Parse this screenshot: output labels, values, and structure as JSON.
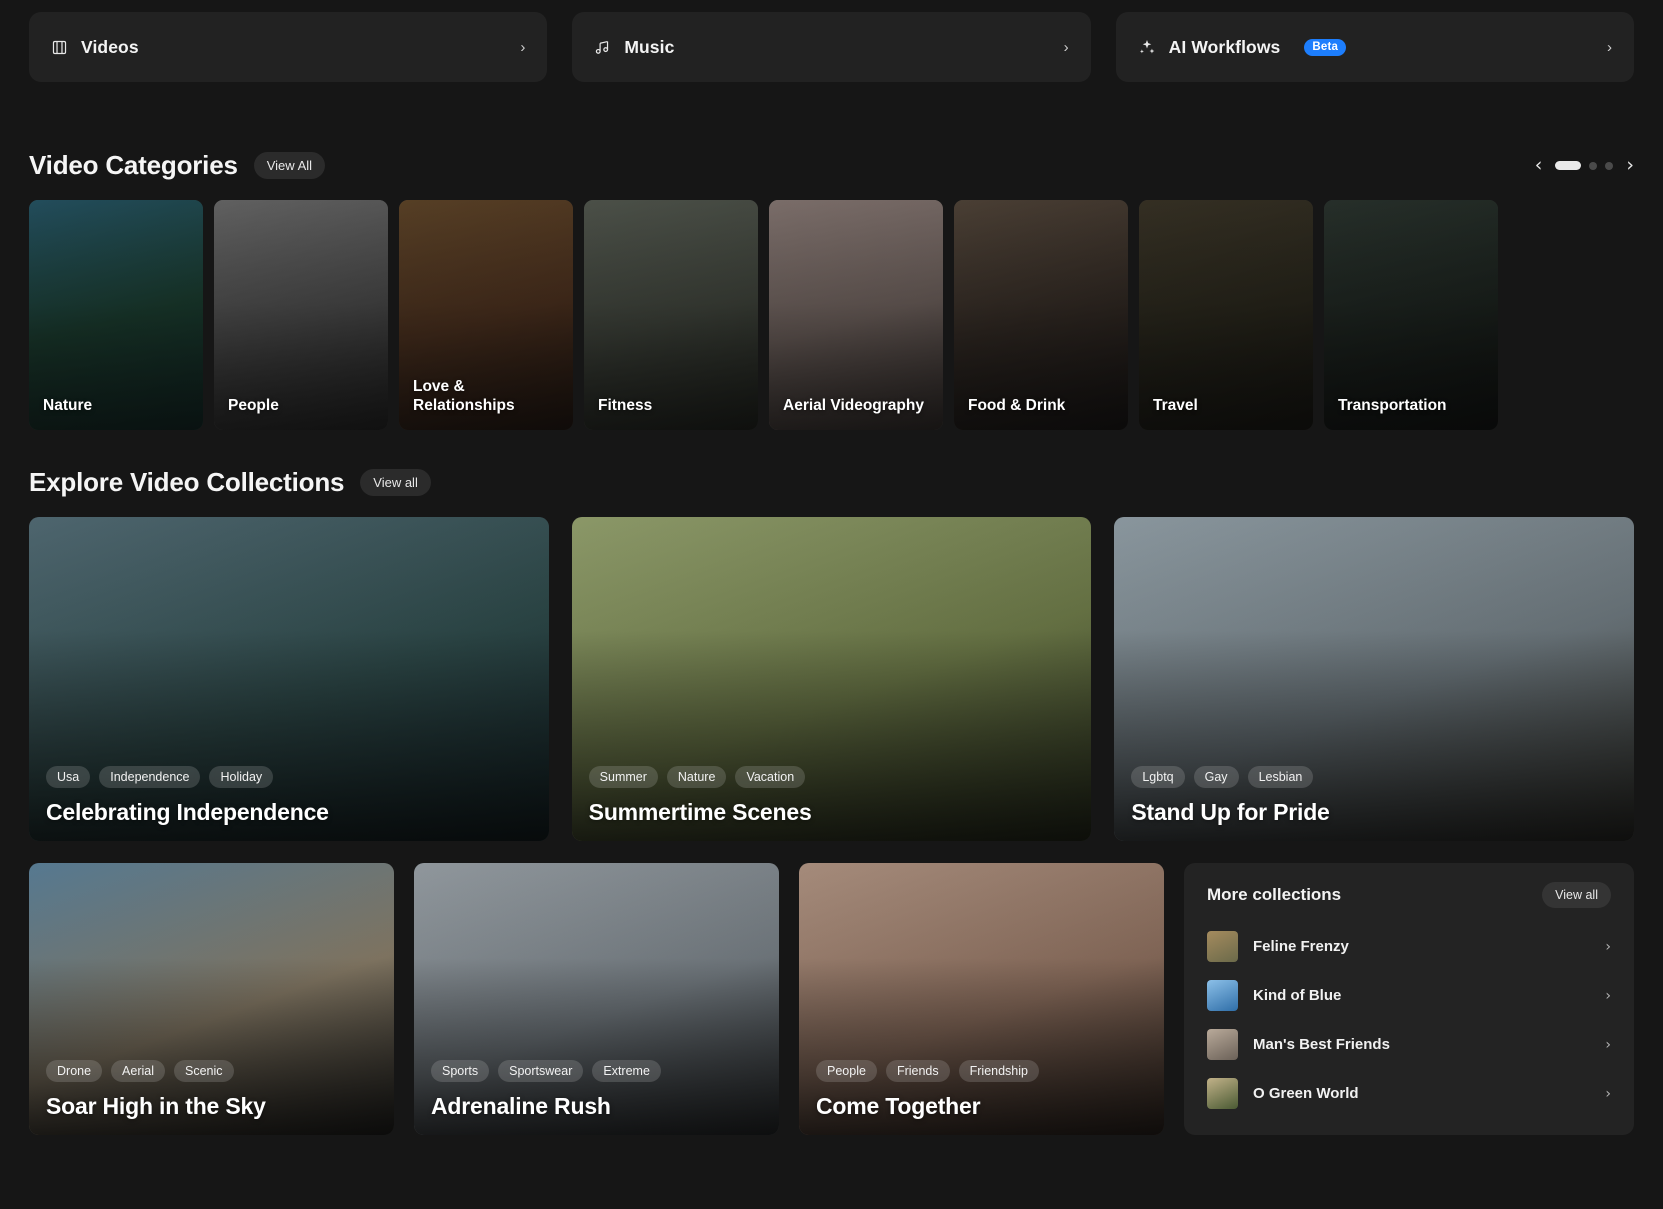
{
  "nav_tiles": [
    {
      "label": "Videos",
      "icon": "film-icon",
      "chevron": "›"
    },
    {
      "label": "Music",
      "icon": "music-note-icon",
      "chevron": "›"
    },
    {
      "label": "AI Workflows",
      "icon": "sparkles-icon",
      "badge": "Beta",
      "chevron": "›"
    }
  ],
  "video_categories": {
    "title": "Video Categories",
    "view_all_label": "View All",
    "prev_arrow": "‹",
    "next_arrow": "›",
    "pages": 3,
    "active_page": 1,
    "items": [
      {
        "label": "Nature",
        "c1": "#2f6f86",
        "c2": "#1d4a38",
        "c3": "#0d2c28"
      },
      {
        "label": "People",
        "c1": "#8d8d8d",
        "c2": "#5c5c5c",
        "c3": "#262626"
      },
      {
        "label": "Love & Relationships",
        "c1": "#7d5a33",
        "c2": "#5e3a22",
        "c3": "#24140c"
      },
      {
        "label": "Fitness",
        "c1": "#6d7468",
        "c2": "#4d5348",
        "c3": "#20241d"
      },
      {
        "label": "Aerial Videography",
        "c1": "#b4a09a",
        "c2": "#8b7a74",
        "c3": "#3b3330"
      },
      {
        "label": "Food & Drink",
        "c1": "#6b5a4a",
        "c2": "#3c3129",
        "c3": "#151110"
      },
      {
        "label": "Travel",
        "c1": "#4a4230",
        "c2": "#2f2c1e",
        "c3": "#14130d"
      },
      {
        "label": "Transportation",
        "c1": "#35423a",
        "c2": "#1f2822",
        "c3": "#0b0e0c"
      }
    ]
  },
  "explore_collections": {
    "title": "Explore Video Collections",
    "view_all_label": "View all",
    "featured": [
      {
        "title": "Celebrating Independence",
        "tags": [
          "Usa",
          "Independence",
          "Holiday"
        ],
        "c1": "#56707a",
        "c2": "#2e4a4a",
        "c3": "#14262a"
      },
      {
        "title": "Summertime Scenes",
        "tags": [
          "Summer",
          "Nature",
          "Vacation"
        ],
        "c1": "#9aa873",
        "c2": "#6e7b49",
        "c3": "#2f3720"
      },
      {
        "title": "Stand Up for Pride",
        "tags": [
          "Lgbtq",
          "Gay",
          "Lesbian"
        ],
        "c1": "#98a6ae",
        "c2": "#6f7a80",
        "c3": "#3a3a34"
      }
    ],
    "secondary": [
      {
        "title": "Soar High in the Sky",
        "tags": [
          "Drone",
          "Aerial",
          "Scenic"
        ],
        "c1": "#5f86a0",
        "c2": "#8b7f6a",
        "c3": "#2b2a26"
      },
      {
        "title": "Adrenaline Rush",
        "tags": [
          "Sports",
          "Sportswear",
          "Extreme"
        ],
        "c1": "#9fa7ad",
        "c2": "#777f85",
        "c3": "#34383b"
      },
      {
        "title": "Come Together",
        "tags": [
          "People",
          "Friends",
          "Friendship"
        ],
        "c1": "#b79a88",
        "c2": "#8d6f5e",
        "c3": "#3c2e26"
      }
    ]
  },
  "more_collections": {
    "title": "More collections",
    "view_all_label": "View all",
    "chevron": "›",
    "items": [
      {
        "label": "Feline Frenzy",
        "t1": "#a58b5e",
        "t2": "#6b6a4a"
      },
      {
        "label": "Kind of Blue",
        "t1": "#8cc0e8",
        "t2": "#2f6ea8"
      },
      {
        "label": "Man's Best Friends",
        "t1": "#b9aa9a",
        "t2": "#6b6158"
      },
      {
        "label": "O Green World",
        "t1": "#c2b289",
        "t2": "#4a5a33"
      }
    ]
  }
}
